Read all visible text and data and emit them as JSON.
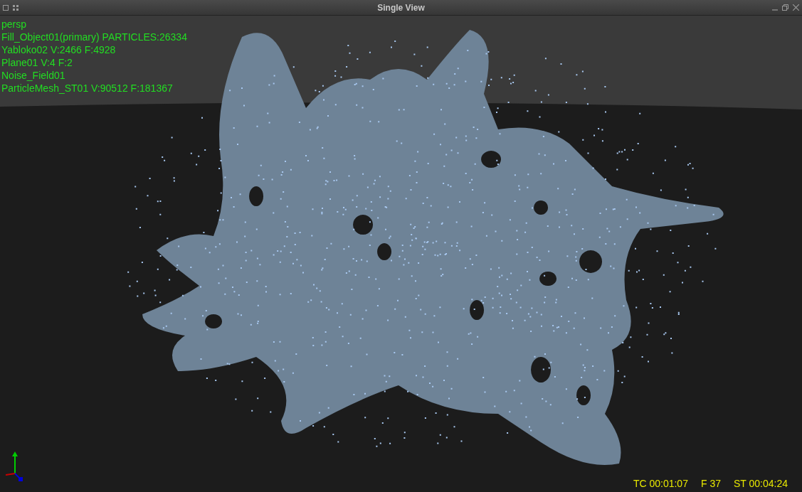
{
  "window": {
    "title": "Single View"
  },
  "viewport": {
    "camera": "persp",
    "scene_info": [
      "Fill_Object01(primary) PARTICLES:26334",
      "Yabloko02 V:2466 F:4928",
      "Plane01 V:4 F:2",
      "Noise_Field01",
      "ParticleMesh_ST01 V:90512 F:181367"
    ],
    "status": {
      "timecode": "TC 00:01:07",
      "frame": "F 37",
      "sim_time": "ST 00:04:24"
    }
  }
}
